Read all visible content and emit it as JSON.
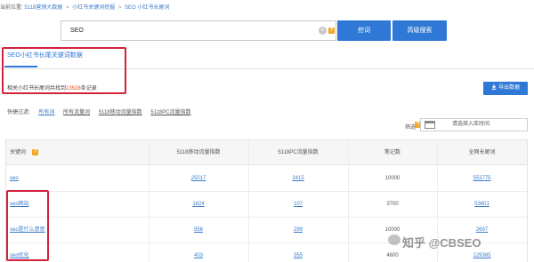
{
  "breadcrumb": {
    "label": "当前位置:",
    "items": [
      "5118营销大数据",
      "小红书关键词挖掘",
      "SEO 小红书长尾词"
    ],
    "separator": ">"
  },
  "search": {
    "value": "SEO",
    "clear_icon": "×",
    "help_badge": "?",
    "search_button": "挖词",
    "advanced_button": "高级搜索"
  },
  "tab": {
    "label": "SEO小红书长尾关键词数据"
  },
  "summary": {
    "prefix": "相关小红书长尾词共找到",
    "count": "13528",
    "suffix": "条记录"
  },
  "export_button": "导出数据",
  "quick_filter": {
    "label": "快捷过滤:",
    "options": [
      "所有词",
      "所有流量词",
      "5118移动流量指数",
      "5118PC流量指数"
    ]
  },
  "filter": {
    "label": "筛选",
    "badge": "?",
    "time_placeholder": "请选择入库时间"
  },
  "table": {
    "headers": [
      "关键词",
      "5118移动流量指数",
      "5118PC流量指数",
      "笔记数",
      "全网长尾词"
    ],
    "rows": [
      {
        "keyword": "seo",
        "mobile": "25017",
        "pc": "2415",
        "notes": "10000",
        "longtail": "553775"
      },
      {
        "keyword": "seo网站",
        "mobile": "1624",
        "pc": "107",
        "notes": "3700",
        "longtail": "53601"
      },
      {
        "keyword": "seo是什么意思",
        "mobile": "956",
        "pc": "299",
        "notes": "10000",
        "longtail": "2697"
      },
      {
        "keyword": "seo优化",
        "mobile": "403",
        "pc": "355",
        "notes": "4600",
        "longtail": "129385"
      }
    ]
  },
  "watermark": "知乎 @CBSEO",
  "colors": {
    "accent": "#2f78d6",
    "highlight_box": "#d2233b",
    "count": "#e84e1a",
    "badge": "#f5a623"
  }
}
